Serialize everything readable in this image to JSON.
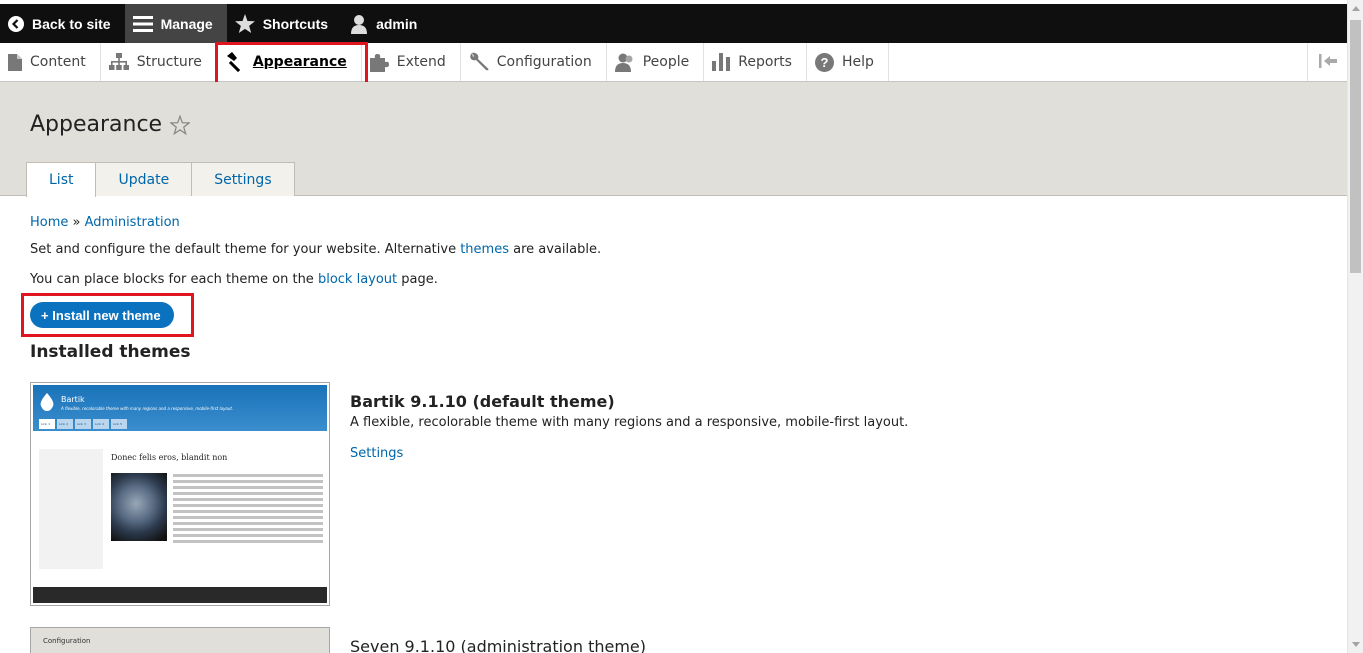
{
  "toolbar": {
    "back": "Back to site",
    "manage": "Manage",
    "shortcuts": "Shortcuts",
    "user": "admin"
  },
  "tray": {
    "items": [
      "Content",
      "Structure",
      "Appearance",
      "Extend",
      "Configuration",
      "People",
      "Reports",
      "Help"
    ]
  },
  "page": {
    "title": "Appearance",
    "tabs": [
      "List",
      "Update",
      "Settings"
    ]
  },
  "breadcrumb": {
    "home": "Home",
    "sep": "»",
    "admin": "Administration"
  },
  "intro": {
    "p1_before": "Set and configure the default theme for your website. Alternative ",
    "p1_link": "themes",
    "p1_after": " are available.",
    "p2_before": "You can place blocks for each theme on the ",
    "p2_link": "block layout",
    "p2_after": " page."
  },
  "install_button": "+ Install new theme",
  "installed_heading": "Installed themes",
  "themes": [
    {
      "name": "Bartik 9.1.10 (default theme)",
      "description": "A flexible, recolorable theme with many regions and a responsive, mobile-first layout.",
      "settings_link": "Settings",
      "thumb_site_name": "Bartik",
      "thumb_slogan": "A flexible, recolorable theme with many regions and a responsive, mobile-first layout.",
      "thumb_tabs": [
        "Link 1",
        "Link 2",
        "Link 3",
        "Link 4",
        "Link 5"
      ],
      "thumb_article_title": "Donec felis eros, blandit non"
    },
    {
      "name": "Seven 9.1.10 (administration theme)",
      "thumb_title": "Configuration"
    }
  ],
  "colors": {
    "toolbar_bg": "#0f0f0f",
    "link": "#0066a9",
    "button": "#0b72c0",
    "highlight": "#e0151f",
    "header_bg": "#e0dfd9"
  }
}
